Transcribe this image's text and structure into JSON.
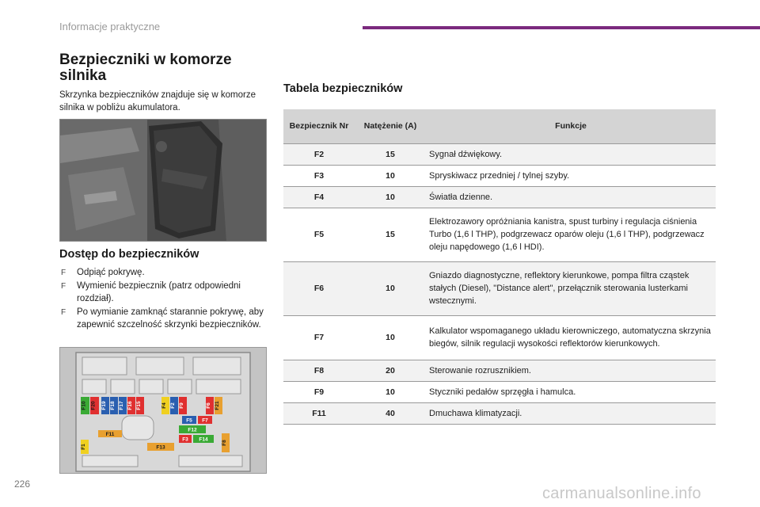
{
  "header": {
    "section": "Informacje praktyczne",
    "accent": "#7b2a7e"
  },
  "left": {
    "title": "Bezpieczniki w komorze silnika",
    "intro": "Skrzynka bezpieczników znajduje się w komorze silnika w pobliżu akumulatora.",
    "access_title": "Dostęp do bezpieczników",
    "steps": [
      "Odpiąć pokrywę.",
      "Wymienić bezpiecznik (patrz odpowiedni rozdział).",
      "Po wymianie zamknąć starannie pokrywę, aby zapewnić szczelność skrzynki bezpieczników."
    ],
    "step_bullet": "F"
  },
  "fusebox_labels": [
    "F10",
    "F20",
    "F19",
    "F18",
    "F17",
    "F16",
    "F15",
    "F4",
    "F2",
    "F9",
    "F6",
    "F21",
    "F5",
    "F7",
    "F12",
    "F11",
    "F3",
    "F14",
    "F13",
    "F8",
    "F1"
  ],
  "table": {
    "title": "Tabela bezpieczników",
    "headers": {
      "nr": "Bezpiecznik Nr",
      "amp": "Natężenie (A)",
      "func": "Funkcje"
    },
    "rows": [
      {
        "nr": "F2",
        "amp": "15",
        "func": "Sygnał dźwiękowy."
      },
      {
        "nr": "F3",
        "amp": "10",
        "func": "Spryskiwacz przedniej / tylnej szyby."
      },
      {
        "nr": "F4",
        "amp": "10",
        "func": "Światła dzienne."
      },
      {
        "nr": "F5",
        "amp": "15",
        "func": "Elektrozawory opróżniania kanistra, spust turbiny i regulacja ciśnienia Turbo (1,6 l THP), podgrzewacz oparów oleju (1,6 l THP), podgrzewacz oleju napędowego (1,6 l HDI)."
      },
      {
        "nr": "F6",
        "amp": "10",
        "func": "Gniazdo diagnostyczne, reflektory kierunkowe, pompa filtra cząstek stałych (Diesel), \"Distance alert\", przełącznik sterowania lusterkami wstecznymi."
      },
      {
        "nr": "F7",
        "amp": "10",
        "func": "Kalkulator wspomaganego układu kierowniczego, automatyczna skrzynia biegów, silnik regulacji wysokości reflektorów kierunkowych."
      },
      {
        "nr": "F8",
        "amp": "20",
        "func": "Sterowanie rozrusznikiem."
      },
      {
        "nr": "F9",
        "amp": "10",
        "func": "Styczniki pedałów sprzęgła i hamulca."
      },
      {
        "nr": "F11",
        "amp": "40",
        "func": "Dmuchawa klimatyzacji."
      }
    ]
  },
  "footer": {
    "page_number": "226",
    "watermark": "carmanualsonline.info"
  }
}
